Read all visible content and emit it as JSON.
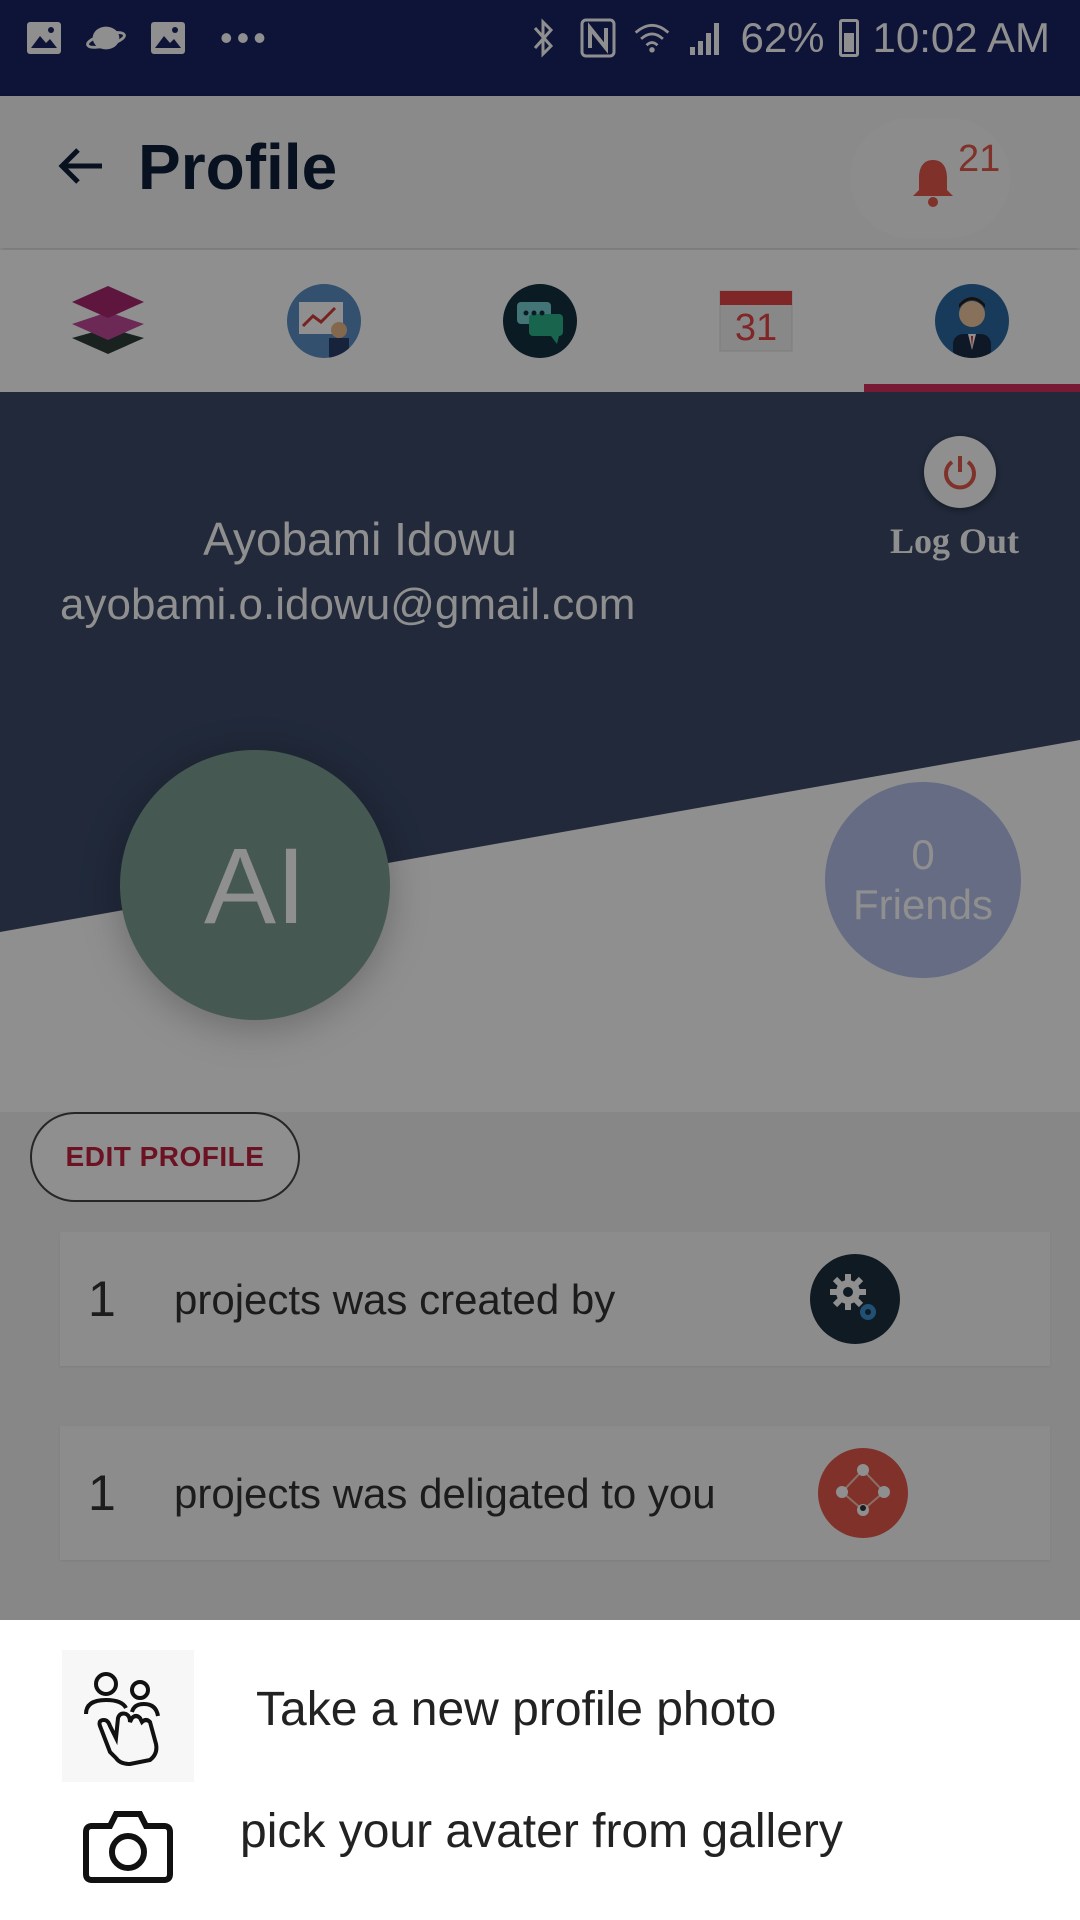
{
  "status_bar": {
    "battery": "62%",
    "time": "10:02 AM"
  },
  "app_bar": {
    "title": "Profile",
    "notification_count": "21"
  },
  "tabs": [
    {
      "name": "layers-icon",
      "active": false
    },
    {
      "name": "presentation-icon",
      "active": false
    },
    {
      "name": "chat-icon",
      "active": false
    },
    {
      "name": "calendar-icon",
      "active": false,
      "label": "31"
    },
    {
      "name": "user-avatar-icon",
      "active": true
    }
  ],
  "profile": {
    "name": "Ayobami Idowu",
    "email": "ayobami.o.idowu@gmail.com",
    "logout_label": "Log Out",
    "avatar_initials": "AI",
    "friends_count": "0",
    "friends_label": "Friends"
  },
  "actions": {
    "edit_profile_label": "EDIT PROFILE"
  },
  "stats": [
    {
      "count": "1",
      "text": "projects was created by",
      "icon": "gears-icon"
    },
    {
      "count": "1",
      "text": "projects was deligated to you",
      "icon": "delegate-network-icon"
    }
  ],
  "bottom_sheet": {
    "options": [
      {
        "label": "Take a new profile photo",
        "icon": "touch-people-icon"
      },
      {
        "label": "pick your avater from gallery",
        "icon": "camera-icon"
      }
    ]
  },
  "colors": {
    "status_bar": "#1a2264",
    "accent": "#d62f5d",
    "header_dark": "#3b4a68",
    "notification": "#e2584b"
  }
}
